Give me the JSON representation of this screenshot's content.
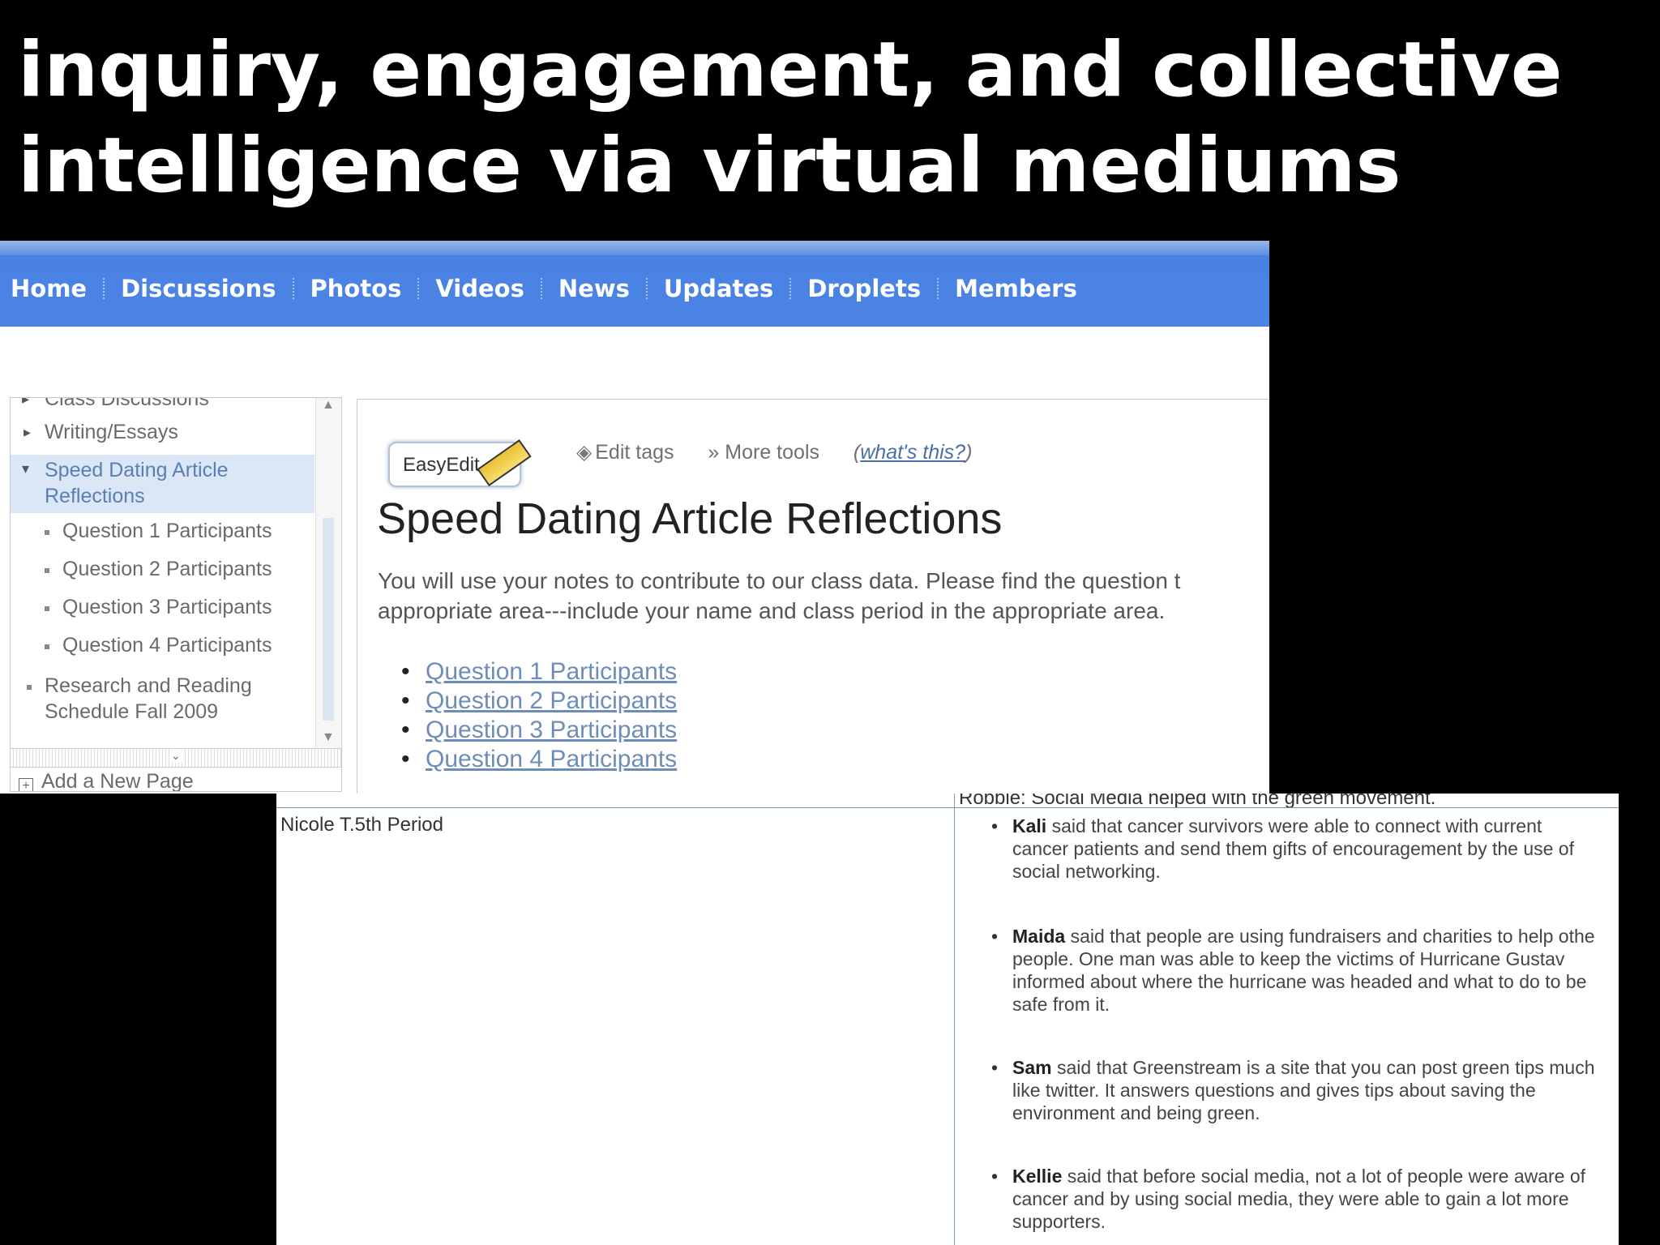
{
  "slide": {
    "title_line1": "inquiry, engagement, and collective",
    "title_line2": "intelligence via virtual mediums"
  },
  "nav": {
    "items": [
      "Home",
      "Discussions",
      "Photos",
      "Videos",
      "News",
      "Updates",
      "Droplets",
      "Members"
    ]
  },
  "sidebar": {
    "items": [
      {
        "label": "Class Discussions"
      },
      {
        "label": "Writing/Essays"
      },
      {
        "label_line1": "Speed Dating Article",
        "label_line2": "Reflections"
      },
      {
        "label": "Question 1 Participants"
      },
      {
        "label": "Question 2 Participants"
      },
      {
        "label": "Question 3 Participants"
      },
      {
        "label": "Question 4 Participants"
      },
      {
        "label_line1": "Research and Reading",
        "label_line2": "Schedule Fall 2009"
      }
    ],
    "add_page": "Add a New Page"
  },
  "toolbar": {
    "easyedit": "EasyEdit",
    "edit_tags": "Edit tags",
    "more_tools": "More tools",
    "help_open": "(",
    "help_link": "what's this?",
    "help_close": ")"
  },
  "page": {
    "title": "Speed Dating Article Reflections",
    "intro_line1": "You will use your notes to contribute to our class data. Please find the question t",
    "intro_line2": "appropriate area---include your name and class period in the appropriate area.",
    "links": [
      "Question 1 Participants",
      "Question 2 Participants",
      "Question 3 Participants",
      "Question 4 Participants"
    ]
  },
  "history": {
    "left_cell": "Nicole T.5th Period",
    "cut_line": "Robbie: Social Media helped with the green movement.",
    "entries": [
      {
        "name": "Kali",
        "l1": " said that cancer survivors were able to connect with current",
        "l2": "cancer patients and send them gifts of encouragement by the use of",
        "l3": "social networking."
      },
      {
        "name": "Maida",
        "l1": " said that people are using fundraisers and charities to help othe",
        "l2": "people. One man was able to keep the victims of Hurricane Gustav",
        "l3": "informed about where the hurricane was headed and what to do to be",
        "l4": "safe from it."
      },
      {
        "name": "Sam",
        "l1": " said that Greenstream is a site that you can post green tips much",
        "l2": "like twitter. It answers questions and gives tips about saving the",
        "l3": "environment and being green."
      },
      {
        "name": "Kellie",
        "l1": " said that before social media, not a lot of people were aware of",
        "l2": "cancer and by using social media, they were able to gain a lot more",
        "l3": "supporters."
      }
    ]
  }
}
